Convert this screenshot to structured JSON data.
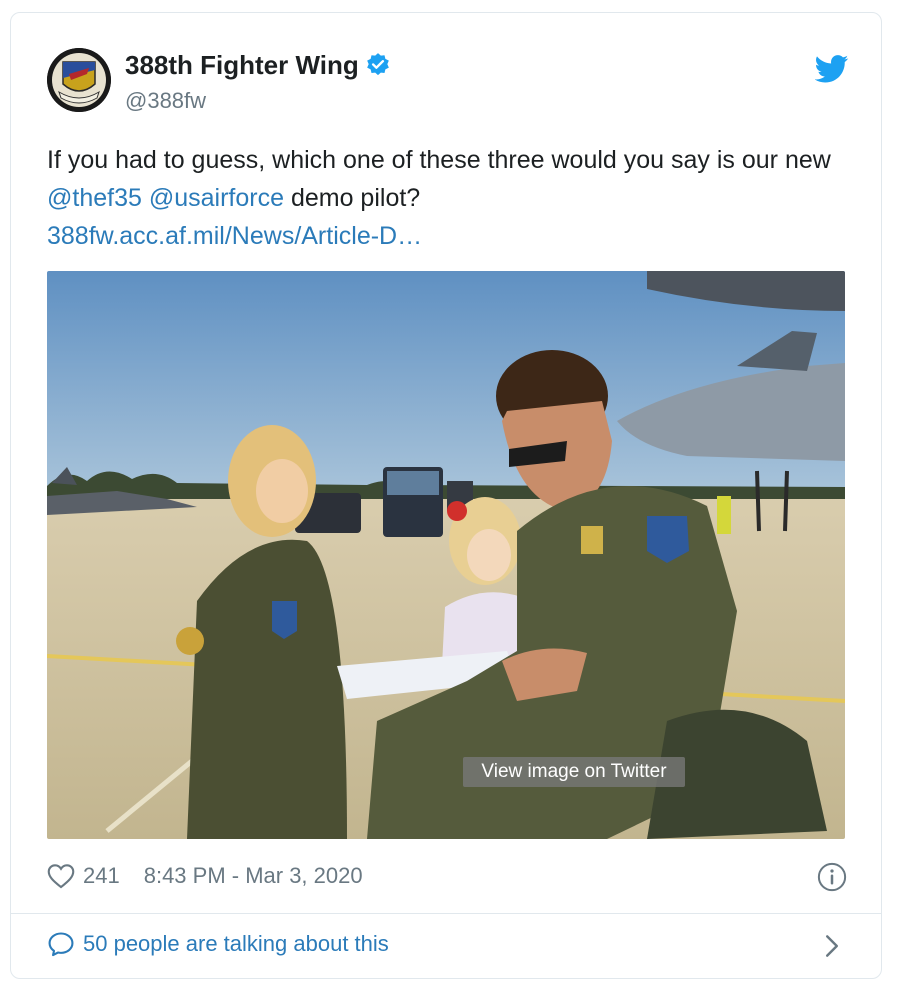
{
  "tweet": {
    "author_name": "388th Fighter Wing",
    "handle": "@388fw",
    "text_part1": "If you had to guess, which one of these three would you say is our new ",
    "mention1": "@thef35",
    "mention2": "@usairforce",
    "text_part2": " demo pilot?",
    "url": "388fw.acc.af.mil/News/Article-D…",
    "view_image_label": "View image on Twitter",
    "likes": "241",
    "timestamp": "8:43 PM - Mar 3, 2020",
    "talking_label": "50 people are talking about this"
  },
  "icons": {
    "verified": "verified-badge-icon",
    "logo": "twitter-bird-icon",
    "like": "heart-icon",
    "info": "info-icon",
    "reply": "speech-bubble-icon",
    "more": "chevron-right-icon"
  },
  "colors": {
    "link": "#2b7bb9",
    "twitter_blue": "#1da1f2",
    "muted": "#697882",
    "border": "#e1e8ed"
  }
}
